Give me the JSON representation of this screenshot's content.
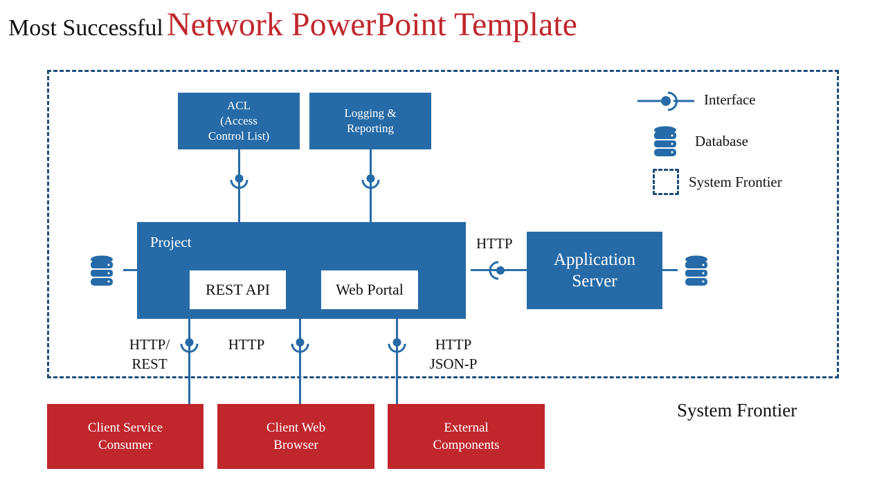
{
  "title": {
    "prefix": "Most Successful",
    "main": "Network PowerPoint Template"
  },
  "legend": [
    {
      "icon": "interface-icon",
      "label": "Interface"
    },
    {
      "icon": "database-icon",
      "label": "Database"
    },
    {
      "icon": "system-frontier-icon",
      "label": "System Frontier"
    }
  ],
  "top_boxes": [
    {
      "label": "ACL\n(Access\nControl List)"
    },
    {
      "label": "Logging &\nReporting"
    }
  ],
  "project": {
    "label": "Project",
    "components": [
      {
        "label": "REST API"
      },
      {
        "label": "Web Portal"
      }
    ]
  },
  "app_server": {
    "label": "Application\nServer",
    "connection_label": "HTTP"
  },
  "bottom_connections": [
    {
      "label": "HTTP/\nREST"
    },
    {
      "label": "HTTP"
    },
    {
      "label": "HTTP\nJSON-P"
    }
  ],
  "clients": [
    {
      "label": "Client Service\nConsumer"
    },
    {
      "label": "Client Web\nBrowser"
    },
    {
      "label": "External\nComponents"
    }
  ],
  "frontier_label": "System Frontier",
  "colors": {
    "primary_blue": "#266ba7",
    "accent_red": "#c0272d",
    "frontier_border": "#1f4e79"
  }
}
